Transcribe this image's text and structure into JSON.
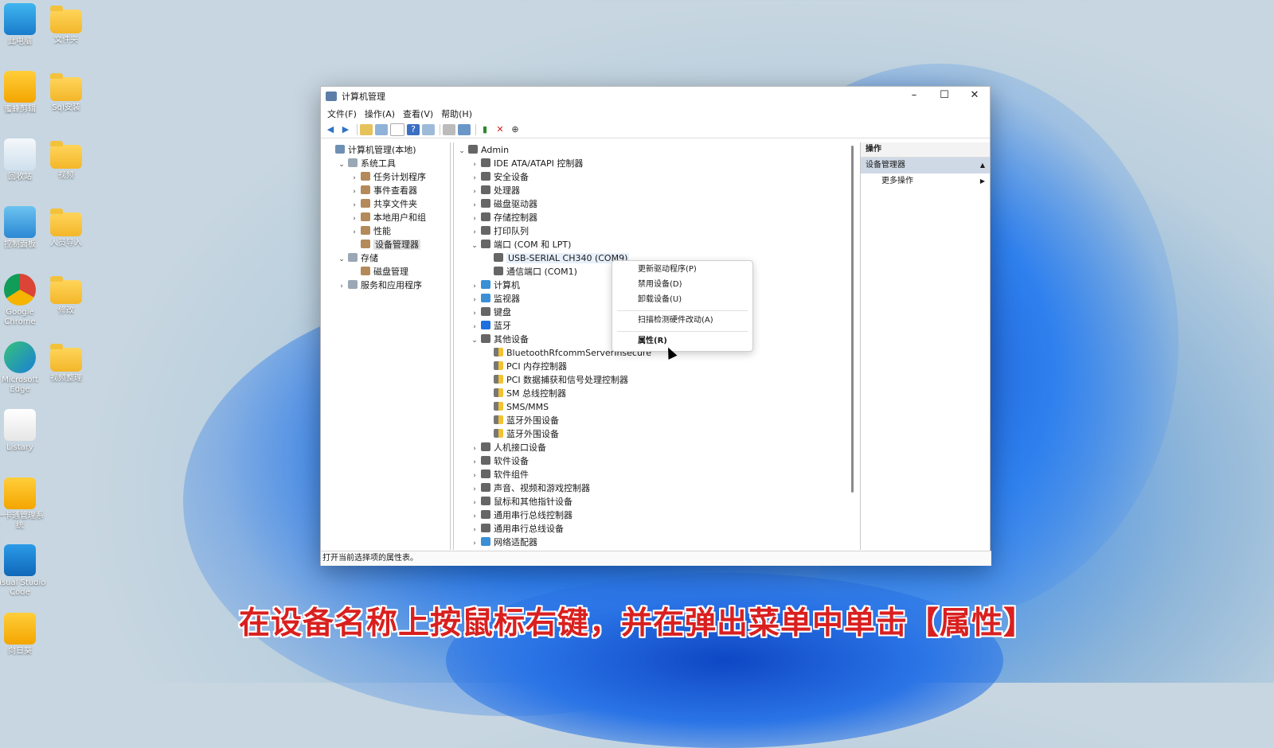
{
  "desktop_icons": [
    {
      "label": "此电脑",
      "icon": "monitor-icon"
    },
    {
      "label": "文件夹",
      "icon": "folder-icon"
    },
    {
      "label": "蜜蜂剪辑",
      "icon": "app-icon"
    },
    {
      "label": "Sql安装",
      "icon": "folder-icon"
    },
    {
      "label": "回收站",
      "icon": "recycle-bin-icon"
    },
    {
      "label": "视频",
      "icon": "folder-icon"
    },
    {
      "label": "控制面板",
      "icon": "control-panel-icon"
    },
    {
      "label": "人员导入",
      "icon": "folder-icon"
    },
    {
      "label": "Google Chrome",
      "icon": "chrome-icon"
    },
    {
      "label": "修改",
      "icon": "folder-icon"
    },
    {
      "label": "Microsoft Edge",
      "icon": "edge-icon"
    },
    {
      "label": "视频整理",
      "icon": "folder-icon"
    },
    {
      "label": "Listary",
      "icon": "listary-icon"
    },
    {
      "label": "一卡通管理系统",
      "icon": "app-icon"
    },
    {
      "label": "Visual Studio Code",
      "icon": "vscode-icon"
    },
    {
      "label": "向日葵",
      "icon": "app-icon"
    }
  ],
  "window": {
    "title": "计算机管理",
    "menu": [
      "文件(F)",
      "操作(A)",
      "查看(V)",
      "帮助(H)"
    ],
    "left_tree": [
      {
        "label": "计算机管理(本地)",
        "level": 0,
        "expand": ""
      },
      {
        "label": "系统工具",
        "level": 1,
        "expand": "⌄"
      },
      {
        "label": "任务计划程序",
        "level": 2,
        "expand": "›"
      },
      {
        "label": "事件查看器",
        "level": 2,
        "expand": "›"
      },
      {
        "label": "共享文件夹",
        "level": 2,
        "expand": "›"
      },
      {
        "label": "本地用户和组",
        "level": 2,
        "expand": "›"
      },
      {
        "label": "性能",
        "level": 2,
        "expand": "›"
      },
      {
        "label": "设备管理器",
        "level": 2,
        "expand": "",
        "selected": true
      },
      {
        "label": "存储",
        "level": 1,
        "expand": "⌄"
      },
      {
        "label": "磁盘管理",
        "level": 2,
        "expand": ""
      },
      {
        "label": "服务和应用程序",
        "level": 1,
        "expand": "›"
      }
    ],
    "device_tree": [
      {
        "label": "Admin",
        "level": 0,
        "expand": "⌄"
      },
      {
        "label": "IDE ATA/ATAPI 控制器",
        "level": 1,
        "expand": "›"
      },
      {
        "label": "安全设备",
        "level": 1,
        "expand": "›"
      },
      {
        "label": "处理器",
        "level": 1,
        "expand": "›"
      },
      {
        "label": "磁盘驱动器",
        "level": 1,
        "expand": "›"
      },
      {
        "label": "存储控制器",
        "level": 1,
        "expand": "›"
      },
      {
        "label": "打印队列",
        "level": 1,
        "expand": "›"
      },
      {
        "label": "端口 (COM 和 LPT)",
        "level": 1,
        "expand": "⌄"
      },
      {
        "label": "USB-SERIAL CH340 (COM9)",
        "level": 2,
        "expand": "",
        "highlight": true
      },
      {
        "label": "通信端口 (COM1)",
        "level": 2,
        "expand": ""
      },
      {
        "label": "计算机",
        "level": 1,
        "expand": "›"
      },
      {
        "label": "监视器",
        "level": 1,
        "expand": "›"
      },
      {
        "label": "键盘",
        "level": 1,
        "expand": "›"
      },
      {
        "label": "蓝牙",
        "level": 1,
        "expand": "›"
      },
      {
        "label": "其他设备",
        "level": 1,
        "expand": "⌄"
      },
      {
        "label": "BluetoothRfcommServerInsecure",
        "level": 2,
        "expand": ""
      },
      {
        "label": "PCI 内存控制器",
        "level": 2,
        "expand": ""
      },
      {
        "label": "PCI 数据捕获和信号处理控制器",
        "level": 2,
        "expand": ""
      },
      {
        "label": "SM 总线控制器",
        "level": 2,
        "expand": ""
      },
      {
        "label": "SMS/MMS",
        "level": 2,
        "expand": ""
      },
      {
        "label": "蓝牙外围设备",
        "level": 2,
        "expand": ""
      },
      {
        "label": "蓝牙外围设备",
        "level": 2,
        "expand": ""
      },
      {
        "label": "人机接口设备",
        "level": 1,
        "expand": "›"
      },
      {
        "label": "软件设备",
        "level": 1,
        "expand": "›"
      },
      {
        "label": "软件组件",
        "level": 1,
        "expand": "›"
      },
      {
        "label": "声音、视频和游戏控制器",
        "level": 1,
        "expand": "›"
      },
      {
        "label": "鼠标和其他指针设备",
        "level": 1,
        "expand": "›"
      },
      {
        "label": "通用串行总线控制器",
        "level": 1,
        "expand": "›"
      },
      {
        "label": "通用串行总线设备",
        "level": 1,
        "expand": "›"
      },
      {
        "label": "网络适配器",
        "level": 1,
        "expand": "›"
      }
    ],
    "actions": {
      "header": "操作",
      "section": "设备管理器",
      "more": "更多操作"
    },
    "status": "打开当前选择项的属性表。"
  },
  "context_menu": {
    "items": [
      "更新驱动程序(P)",
      "禁用设备(D)",
      "卸载设备(U)",
      "扫描检测硬件改动(A)",
      "属性(R)"
    ]
  },
  "caption": "在设备名称上按鼠标右键，并在弹出菜单中单击【属性】",
  "colors": {
    "caption": "#d9201f",
    "selection": "#e2e2e2",
    "actions_section": "#cfd9e6"
  }
}
